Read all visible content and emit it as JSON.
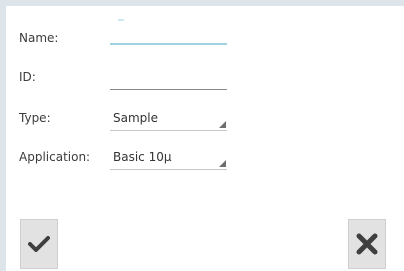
{
  "form": {
    "name": {
      "label": "Name:",
      "value": ""
    },
    "id": {
      "label": "ID:",
      "value": ""
    },
    "type": {
      "label": "Type:",
      "value": "Sample"
    },
    "application": {
      "label": "Application:",
      "value": "Basic 10µ"
    }
  },
  "buttons": {
    "confirm_icon": "checkmark-icon",
    "cancel_icon": "close-icon"
  },
  "colors": {
    "background": "#dde4ea",
    "focused_underline": "#9fd3e2",
    "button_bg": "#e2e2e2",
    "icon": "#3f3f3f"
  }
}
